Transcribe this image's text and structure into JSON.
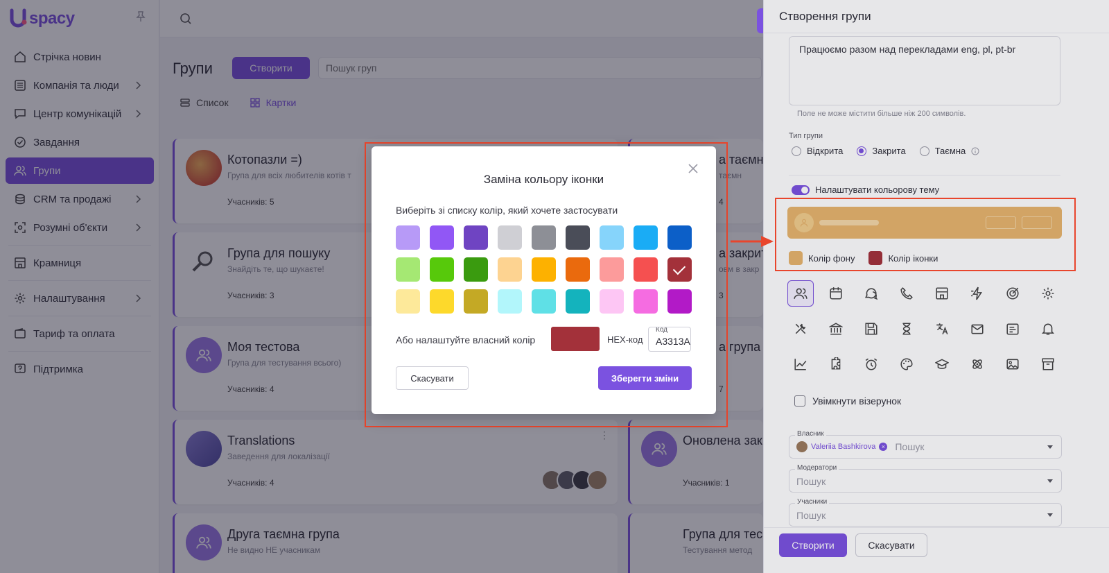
{
  "app": {
    "logo_text": "spacy"
  },
  "sidebar": {
    "items": [
      {
        "label": "Стрічка новин",
        "icon": "home-icon"
      },
      {
        "label": "Компанія та люди",
        "icon": "building-icon"
      },
      {
        "label": "Центр комунікацій",
        "icon": "chat-icon"
      },
      {
        "label": "Завдання",
        "icon": "check-circle-icon"
      },
      {
        "label": "Групи",
        "icon": "users-icon"
      },
      {
        "label": "CRM та продажі",
        "icon": "coins-icon"
      },
      {
        "label": "Розумні об'єкти",
        "icon": "smart-object-icon"
      },
      {
        "label": "Крамниця",
        "icon": "shop-icon"
      },
      {
        "label": "Налаштування",
        "icon": "gear-icon"
      },
      {
        "label": "Тариф та оплата",
        "icon": "wallet-icon"
      },
      {
        "label": "Підтримка",
        "icon": "help-icon"
      }
    ]
  },
  "main": {
    "title": "Групи",
    "create_label": "Створити",
    "search_placeholder": "Пошук груп",
    "tabs": [
      {
        "label": "Список"
      },
      {
        "label": "Картки"
      }
    ],
    "cards": [
      {
        "name": "Котопазли =)",
        "desc": "Група для всіх любителів котів т",
        "members": "Учасників: 5"
      },
      {
        "name": "Група для пошуку",
        "desc": "Знайдіть те, що шукаєте!",
        "members": "Учасників: 3"
      },
      {
        "name": "Моя тестова",
        "desc": "Група для тестування всього)",
        "members": "Учасників: 4"
      },
      {
        "name": "Translations",
        "desc": "Заведення для локалізації",
        "members": "Учасників: 4"
      },
      {
        "name": "Друга таємна група",
        "desc": "Не видно НЕ учасникам",
        "members": ""
      },
      {
        "name": "а таємна",
        "desc": "таємн",
        "members": "4"
      },
      {
        "name": "а закрит",
        "desc": "овм в закр",
        "members": "3"
      },
      {
        "name": "а група",
        "desc": "",
        "members": "7"
      },
      {
        "name": "Оновлена зак",
        "desc": "",
        "members": "Учасників: 1"
      },
      {
        "name": "Група для тес",
        "desc": "Тестування метод",
        "members": ""
      }
    ]
  },
  "drawer": {
    "title": "Створення групи",
    "description_value": "Працюємо разом над перекладами eng, pl, pt-br",
    "hint": "Поле не може містити більше ніж 200 символів.",
    "type_label": "Тип групи",
    "types": [
      {
        "label": "Відкрита",
        "selected": false
      },
      {
        "label": "Закрита",
        "selected": true
      },
      {
        "label": "Таємна",
        "selected": false
      }
    ],
    "theme_toggle_label": "Налаштувати кольорову тему",
    "bg_color_label": "Колір фону",
    "icon_color_label": "Колір іконки",
    "bg_color": "#e8b56d",
    "icon_color": "#a3313a",
    "icons": [
      "users-icon",
      "calendar-icon",
      "chat-bubbles-icon",
      "phone-icon",
      "store-icon",
      "lightning-icon",
      "target-icon",
      "gear-icon",
      "tools-icon",
      "bank-icon",
      "floppy-icon",
      "hourglass-icon",
      "translate-icon",
      "mail-icon",
      "note-icon",
      "bell-icon",
      "chart-icon",
      "puzzle-icon",
      "alarm-icon",
      "palette-icon",
      "graduation-icon",
      "atom-icon",
      "image-icon",
      "archive-icon"
    ],
    "pattern_label": "Увімкнути візерунок",
    "owner_label": "Власник",
    "owner_name": "Valeriia Bashkirova",
    "search_placeholder": "Пошук",
    "moderators_label": "Модератори",
    "members_label": "Учасники",
    "create_label": "Створити",
    "cancel_label": "Скасувати"
  },
  "modal": {
    "title": "Заміна кольору іконки",
    "subtitle": "Виберіть зі списку колір, який хочете застосувати",
    "palette": [
      "#b79af7",
      "#9157f5",
      "#6f44c2",
      "#cfcfd4",
      "#8d8f96",
      "#4a4d58",
      "#86d4fb",
      "#1aacf5",
      "#0c5fc8",
      "#a5e873",
      "#57c90b",
      "#3a9b0f",
      "#fdd391",
      "#fdb100",
      "#ea6a0d",
      "#fc9b9b",
      "#f55050",
      "#a3313a",
      "#fde99a",
      "#fdd92b",
      "#c4a925",
      "#b2f6fb",
      "#5fe0e6",
      "#14b3bd",
      "#fdc6f4",
      "#f56ce1",
      "#b21ac7"
    ],
    "selected_index": 17,
    "custom_label": "Або налаштуйте власний колір",
    "hex_label": "HEX-код",
    "hex_field_label": "Код",
    "hex_value": "A3313A",
    "cancel_label": "Скасувати",
    "save_label": "Зберегти зміни"
  }
}
